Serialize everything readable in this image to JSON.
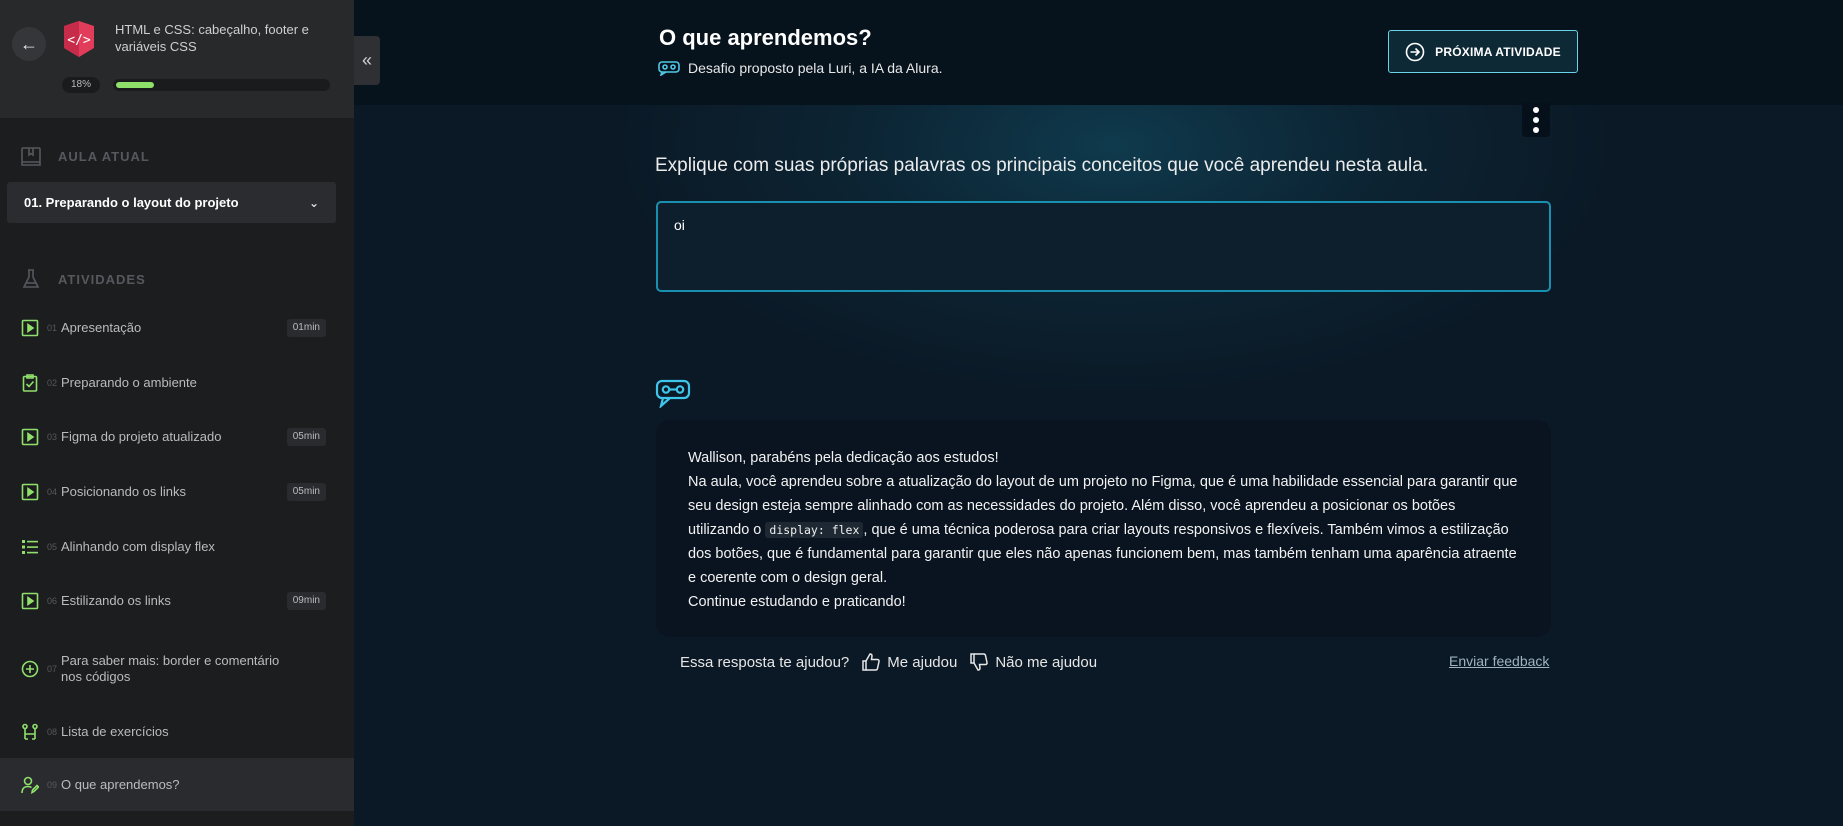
{
  "sidebar": {
    "course_title": "HTML e CSS: cabeçalho, footer e variáveis CSS",
    "progress_label": "18%",
    "progress_fraction": 0.18,
    "aula_atual_label": "AULA ATUAL",
    "aula_select": "01. Preparando o layout do projeto",
    "atividades_label": "ATIVIDADES",
    "activities": [
      {
        "num": "01",
        "label": "Apresentação",
        "duration": "01min",
        "icon": "video-icon"
      },
      {
        "num": "02",
        "label": "Preparando o ambiente",
        "duration": "",
        "icon": "clipboard-check-icon"
      },
      {
        "num": "03",
        "label": "Figma do projeto atualizado",
        "duration": "05min",
        "icon": "video-icon"
      },
      {
        "num": "04",
        "label": "Posicionando os links",
        "duration": "05min",
        "icon": "video-icon"
      },
      {
        "num": "05",
        "label": "Alinhando com display flex",
        "duration": "",
        "icon": "list-icon"
      },
      {
        "num": "06",
        "label": "Estilizando os links",
        "duration": "09min",
        "icon": "video-icon"
      },
      {
        "num": "07",
        "label": "Para saber mais: border e comentário nos códigos",
        "duration": "",
        "icon": "plus-circle-icon"
      },
      {
        "num": "08",
        "label": "Lista de exercícios",
        "duration": "",
        "icon": "exercise-icon"
      },
      {
        "num": "09",
        "label": "O que aprendemos?",
        "duration": "",
        "icon": "user-edit-icon"
      }
    ]
  },
  "header": {
    "title": "O que aprendemos?",
    "subtitle": "Desafio proposto pela Luri, a IA da Alura.",
    "next_button": "PRÓXIMA ATIVIDADE"
  },
  "main": {
    "question": "Explique com suas próprias palavras os principais conceitos que você aprendeu nesta aula.",
    "answer_value": "oi",
    "feedback": {
      "greeting": "Wallison, parabéns pela dedicação aos estudos!",
      "body_part1": "Na aula, você aprendeu sobre a atualização do layout de um projeto no Figma, que é uma habilidade essencial para garantir que seu design esteja sempre alinhado com as necessidades do projeto. Além disso, você aprendeu a posicionar os botões utilizando o ",
      "code": "display: flex",
      "body_part2": ", que é uma técnica poderosa para criar layouts responsivos e flexíveis. Também vimos a estilização dos botões, que é fundamental para garantir que eles não apenas funcionem bem, mas também tenham uma aparência atraente e coerente com o design geral.",
      "closing": "Continue estudando e praticando!"
    },
    "helpful_question": "Essa resposta te ajudou?",
    "helpful_yes": "Me ajudou",
    "helpful_no": "Não me ajudou",
    "send_feedback": "Enviar feedback"
  },
  "colors": {
    "accent_green": "#8fe06a",
    "accent_cyan": "#6ad3e8",
    "brand_red": "#e23c5b"
  }
}
